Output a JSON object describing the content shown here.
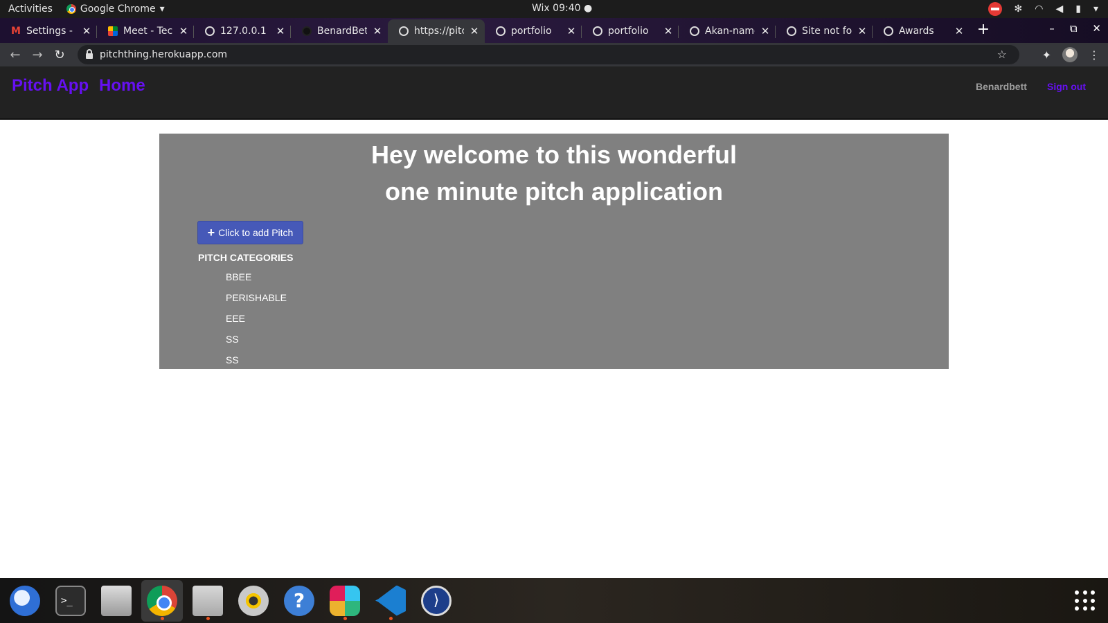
{
  "system_bar": {
    "activities": "Activities",
    "app_name": "Google Chrome",
    "app_menu_arrow": "▾",
    "clock": "Wix 09:40 ●",
    "tray_icons": [
      "no-entry-icon",
      "slack-tray-icon",
      "wifi-icon",
      "volume-icon",
      "battery-icon",
      "system-menu-icon"
    ],
    "tray_menu_arrow": "▾"
  },
  "tabs": [
    {
      "title": "Settings - k",
      "favicon": "gmail-icon",
      "active": false
    },
    {
      "title": "Meet - Tech",
      "favicon": "meet-icon",
      "active": false
    },
    {
      "title": "127.0.0.1",
      "favicon": "globe-icon",
      "active": false
    },
    {
      "title": "BenardBet",
      "favicon": "github-icon",
      "active": false
    },
    {
      "title": "https://pitc",
      "favicon": "globe-icon",
      "active": true
    },
    {
      "title": "portfolio",
      "favicon": "globe-icon",
      "active": false
    },
    {
      "title": "portfolio",
      "favicon": "globe-icon",
      "active": false
    },
    {
      "title": "Akan-name",
      "favicon": "globe-icon",
      "active": false
    },
    {
      "title": "Site not fo",
      "favicon": "globe-icon",
      "active": false
    },
    {
      "title": "Awards",
      "favicon": "globe-icon",
      "active": false
    }
  ],
  "browser": {
    "new_tab": "+",
    "url": "pitchthing.herokuapp.com",
    "back": "←",
    "forward": "→",
    "reload": "↻",
    "star": "☆",
    "extensions": "✦",
    "menu": "⋮",
    "minimize": "–",
    "maximize": "⧉",
    "close": "✕",
    "tab_close": "✕"
  },
  "site": {
    "brand": "Pitch App",
    "home": "Home",
    "username": "Benardbett",
    "signout": "Sign out",
    "welcome_line1": "Hey welcome to this wonderful",
    "welcome_line2": "one minute pitch application",
    "add_pitch_icon": "+",
    "add_pitch": "Click to add Pitch",
    "categories_heading": "PITCH CATEGORIES",
    "categories": [
      "BBEE",
      "PERISHABLE",
      "EEE",
      "SS",
      "SS"
    ]
  },
  "colors": {
    "brand_purple": "#6610f2",
    "navbar_bg": "#222222",
    "jumbotron_bg": "#808080",
    "button_blue": "#4659b8"
  },
  "dock": {
    "apps": [
      "thunderbird-icon",
      "terminal-icon",
      "printer-icon",
      "chrome-icon",
      "files-icon",
      "rhythmbox-icon",
      "help-icon",
      "slack-icon",
      "vscode-icon",
      "devtool-icon"
    ],
    "terminal_glyph": ">_",
    "help_glyph": "?",
    "devtool_glyph": "⟩"
  }
}
